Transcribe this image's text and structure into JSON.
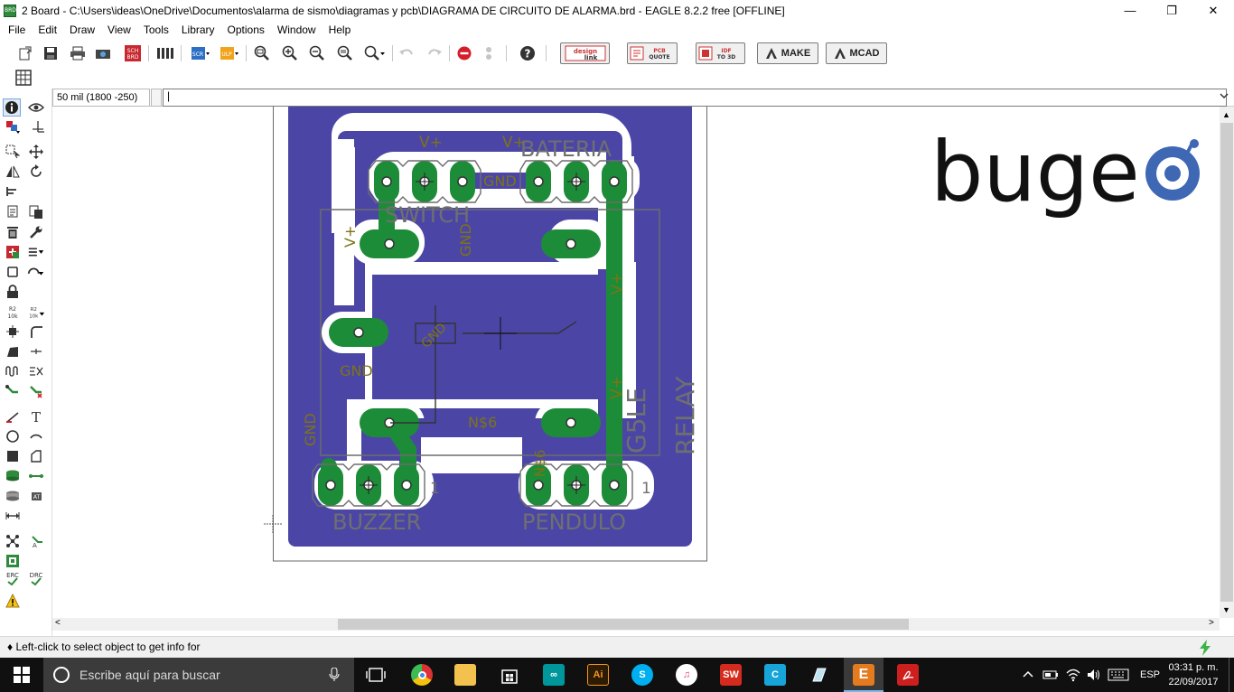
{
  "window": {
    "title": "2 Board - C:\\Users\\ideas\\OneDrive\\Documentos\\alarma de sismo\\diagramas y pcb\\DIAGRAMA DE CIRCUITO DE ALARMA.brd - EAGLE 8.2.2 free [OFFLINE]",
    "app_icon_text": "BRD",
    "minimize": "—",
    "maximize": "❐",
    "close": "✕"
  },
  "menu": [
    "File",
    "Edit",
    "Draw",
    "View",
    "Tools",
    "Library",
    "Options",
    "Window",
    "Help"
  ],
  "toolbar": {
    "icons": [
      "open-icon",
      "save-icon",
      "print-icon",
      "cam-icon",
      "sch-brd-icon",
      "library-icon",
      "script-icon",
      "ulp-icon",
      "zoom-fit-icon",
      "zoom-in-icon",
      "zoom-out-icon",
      "zoom-select-icon",
      "zoom-area-icon",
      "undo-icon",
      "redo-icon",
      "stop-icon",
      "go-icon",
      "help-icon"
    ],
    "sch_label": "SCH BRD",
    "design_link_label": "design link",
    "pcb_quote_label": "PCB QUOTE",
    "idf_label": "IDF TO 3D",
    "make_label": "MAKE",
    "mcad_label": "MCAD"
  },
  "command": {
    "coordinate": "50 mil (1800 -250)",
    "input_value": "|"
  },
  "board": {
    "labels": {
      "vplus_top1": "V+",
      "vplus_top2": "V+",
      "bateria": "BATERIA",
      "gnd_top": "GND",
      "switch": "SWITCH",
      "gnd_switch": "GND",
      "vplus_left": "V+",
      "vplus_right": "V+",
      "gnd_mid": "GND",
      "gnd_resistor": "GND",
      "vplus_relay": "V+",
      "g5le": "G5LE",
      "relay": "RELAY",
      "ns6_mid": "N$6",
      "ns6_vert": "N$6",
      "gnd_lower": "GND",
      "pin1_left": "1",
      "pin1_right": "1",
      "buzzer": "BUZZER",
      "pendulo": "PENDULO"
    },
    "logo_text": "buge",
    "colors": {
      "copper_fill": "#4b46a6",
      "pad": "#1d8c38",
      "silk": "#6d6d6d",
      "label": "#7d7315"
    }
  },
  "status": {
    "text": "♦ Left-click to select object to get info for"
  },
  "taskbar": {
    "search_placeholder": "Escribe aquí para buscar",
    "lang": "ESP",
    "time": "03:31 p. m.",
    "date": "22/09/2017"
  }
}
